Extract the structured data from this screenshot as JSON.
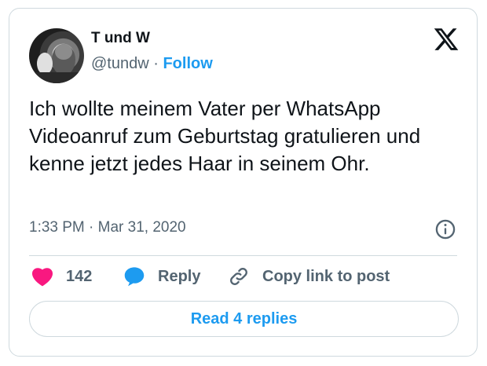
{
  "author": {
    "display_name": "T und W",
    "handle": "@tundw",
    "separator": "·",
    "follow_label": "Follow"
  },
  "tweet": {
    "text": "Ich wollte meinem Vater per WhatsApp Videoanruf zum Geburtstag gratulieren und kenne jetzt jedes Haar in seinem Ohr.",
    "timestamp": "1:33 PM · Mar 31, 2020"
  },
  "actions": {
    "like_count": "142",
    "reply_label": "Reply",
    "copy_link_label": "Copy link to post"
  },
  "footer": {
    "read_replies_label": "Read 4 replies"
  },
  "colors": {
    "accent": "#1d9bf0",
    "like": "#f91880",
    "muted_text": "#536471",
    "border": "#cfd9de"
  },
  "icons": [
    "avatar",
    "x-logo-icon",
    "info-icon",
    "heart-icon",
    "reply-bubble-icon",
    "link-icon"
  ]
}
